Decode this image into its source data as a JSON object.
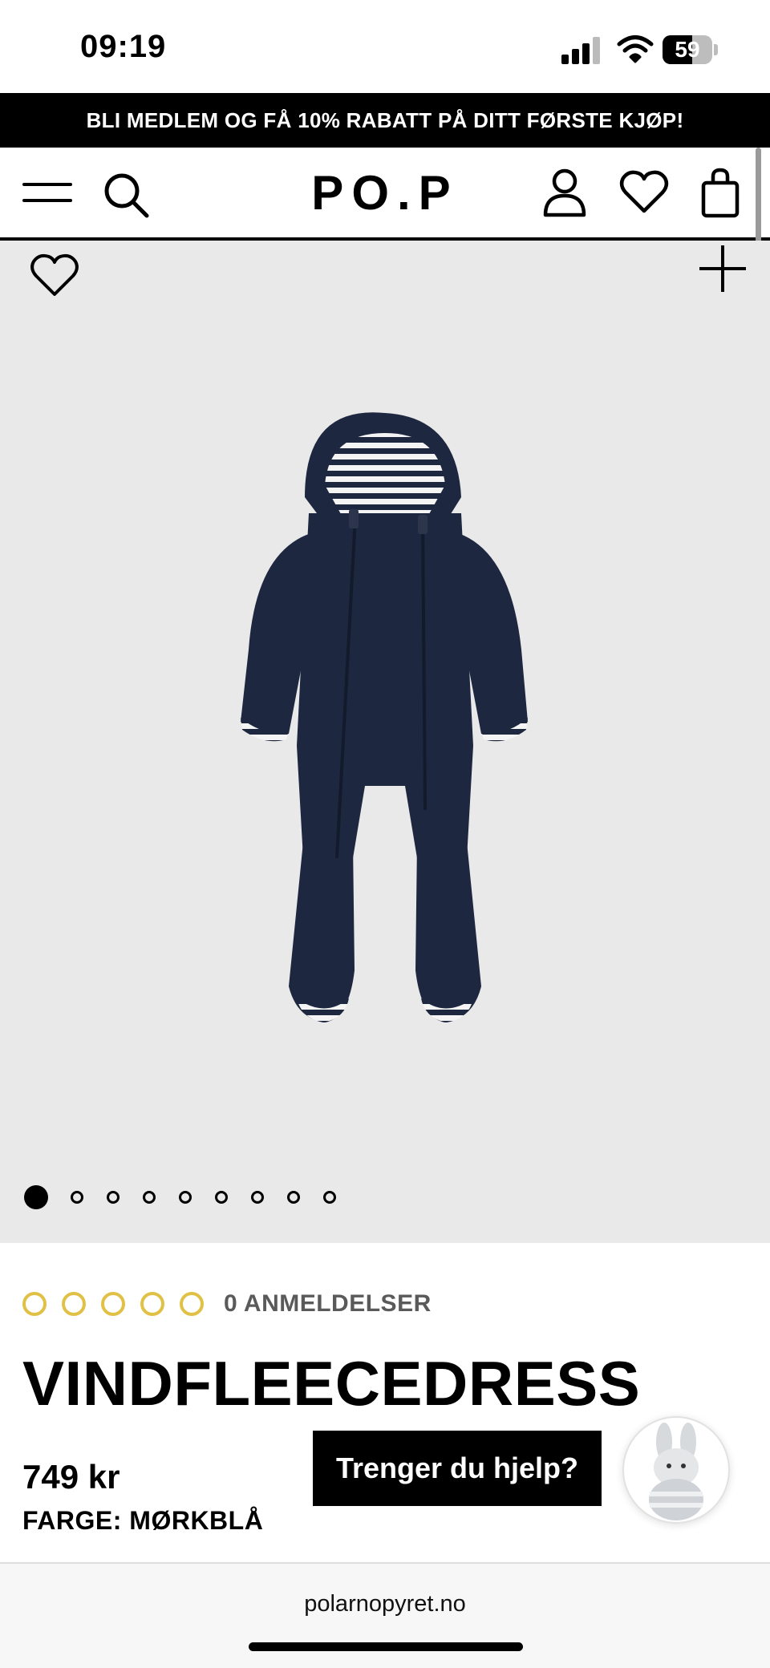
{
  "status_bar": {
    "time": "09:19",
    "battery_level": "59",
    "battery_fraction": 0.59
  },
  "promo_banner": {
    "text": "BLI MEDLEM OG FÅ 10% RABATT PÅ DITT FØRSTE KJØP!"
  },
  "header": {
    "brand": "PO.P"
  },
  "gallery": {
    "image_count": 9,
    "active_index": 0,
    "product_colors": {
      "fleece": "#1d2740",
      "stripe": "#ffffff"
    }
  },
  "product": {
    "rating_count_label": "0 ANMELDELSER",
    "rating_stars": 0,
    "rating_max": 5,
    "title": "VINDFLEECEDRESS",
    "price": "749 kr",
    "color_label": "FARGE: MØRKBLÅ"
  },
  "help": {
    "button_label": "Trenger du hjelp?"
  },
  "browser": {
    "url": "polarnopyret.no"
  },
  "colors": {
    "accent_star": "#e1c145",
    "banner_bg": "#000000",
    "gallery_bg": "#e9e9e9"
  }
}
